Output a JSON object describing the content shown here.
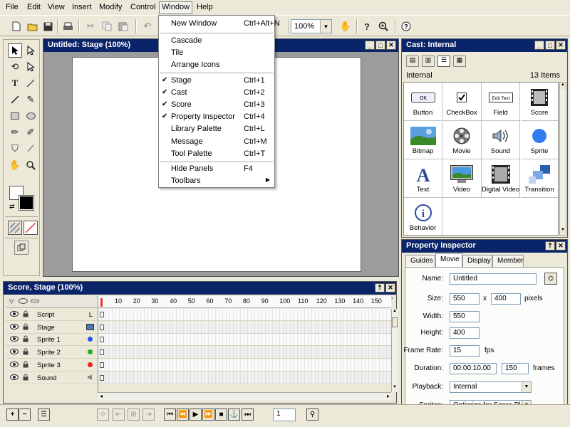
{
  "menubar": {
    "items": [
      "File",
      "Edit",
      "View",
      "Insert",
      "Modify",
      "Control",
      "Window",
      "Help"
    ],
    "active": "Window"
  },
  "toolbar": {
    "zoom": "100%",
    "icons": [
      "new-file-icon",
      "open-folder-icon",
      "save-icon",
      "print-icon",
      "cut-icon",
      "copy-icon",
      "paste-icon",
      "undo-icon",
      "hand-icon",
      "help-pointer-icon",
      "zoom-icon",
      "help-icon"
    ]
  },
  "window_menu": {
    "items": [
      {
        "label": "New Window",
        "shortcut": "Ctrl+Alt+N",
        "checked": false
      },
      {
        "label": "Cascade",
        "shortcut": "",
        "checked": false
      },
      {
        "label": "Tile",
        "shortcut": "",
        "checked": false
      },
      {
        "label": "Arrange Icons",
        "shortcut": "",
        "checked": false
      },
      {
        "label": "Stage",
        "shortcut": "Ctrl+1",
        "checked": true
      },
      {
        "label": "Cast",
        "shortcut": "Ctrl+2",
        "checked": true
      },
      {
        "label": "Score",
        "shortcut": "Ctrl+3",
        "checked": true
      },
      {
        "label": "Property Inspector",
        "shortcut": "Ctrl+4",
        "checked": true
      },
      {
        "label": "Library Palette",
        "shortcut": "Ctrl+L",
        "checked": false
      },
      {
        "label": "Message",
        "shortcut": "Ctrl+M",
        "checked": false
      },
      {
        "label": "Tool Palette",
        "shortcut": "Ctrl+T",
        "checked": false
      },
      {
        "label": "Hide Panels",
        "shortcut": "F4",
        "checked": false
      },
      {
        "label": "Toolbars",
        "shortcut": "",
        "checked": false
      }
    ],
    "checkmark": "✔",
    "submenu_arrow": "▶"
  },
  "stage": {
    "title": "Untitled: Stage (100%)"
  },
  "cast": {
    "title": "Cast: Internal",
    "cast_name": "Internal",
    "count": "13 Items",
    "button_icon_text": "OK",
    "field_icon_text": "Edit Text",
    "text_icon_glyph": "A",
    "behavior_icon_glyph": "i",
    "items": [
      {
        "name": "Button",
        "icon": "button-icon"
      },
      {
        "name": "CheckBox",
        "icon": "checkbox-icon"
      },
      {
        "name": "Field",
        "icon": "field-icon"
      },
      {
        "name": "Score",
        "icon": "score-icon"
      },
      {
        "name": "Bitmap",
        "icon": "bitmap-icon"
      },
      {
        "name": "Movie",
        "icon": "movie-icon"
      },
      {
        "name": "Sound",
        "icon": "sound-icon"
      },
      {
        "name": "Sprite",
        "icon": "sprite-icon"
      },
      {
        "name": "Text",
        "icon": "text-icon"
      },
      {
        "name": "Video",
        "icon": "video-icon"
      },
      {
        "name": "Digital Video",
        "icon": "digital-video-icon"
      },
      {
        "name": "Transition",
        "icon": "transition-icon"
      },
      {
        "name": "Behavior",
        "icon": "behavior-icon"
      }
    ]
  },
  "property_inspector": {
    "title": "Property Inspector",
    "tabs": [
      "Guides",
      "Movie",
      "Display",
      "Member"
    ],
    "selected_tab": "Movie",
    "name_label": "Name:",
    "name_value": "Untitled",
    "size_label": "Size:",
    "size_w": "550",
    "size_x": "x",
    "size_h": "400",
    "size_unit": "pixels",
    "width_label": "Width:",
    "width_value": "550",
    "height_label": "Height:",
    "height_value": "400",
    "framerate_label": "Frame Rate:",
    "framerate_value": "15",
    "framerate_unit": "fps",
    "duration_label": "Duration:",
    "duration_time": "00:00:10.00",
    "duration_frames": "150",
    "duration_unit": "frames",
    "playback_label": "Playback:",
    "playback_value": "Internal",
    "sprites_label": "Sprites:",
    "sprites_value": "Optimize for Score Playback"
  },
  "score": {
    "title": "Score, Stage (100%)",
    "ticks": [
      "10",
      "20",
      "30",
      "40",
      "50",
      "60",
      "70",
      "80",
      "90",
      "100",
      "110",
      "120",
      "130",
      "140",
      "150"
    ],
    "channels": [
      {
        "label": "Script",
        "marker": "L",
        "color": ""
      },
      {
        "label": "Stage",
        "marker": "",
        "color": "#4a7ab8"
      },
      {
        "label": "Sprite 1",
        "marker": "",
        "color": "#2255ee"
      },
      {
        "label": "Sprite 2",
        "marker": "",
        "color": "#22aa22"
      },
      {
        "label": "Sprite 3",
        "marker": "",
        "color": "#ee2222"
      },
      {
        "label": "Sound",
        "marker": "",
        "color": "#888888"
      }
    ]
  },
  "bottom": {
    "frame_value": "1",
    "add_label": "+",
    "remove_label": "−"
  }
}
